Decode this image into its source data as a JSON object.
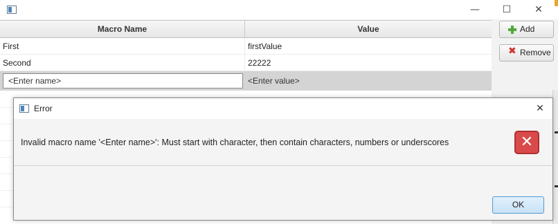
{
  "window": {
    "minimize_glyph": "—",
    "maximize_glyph": "☐",
    "close_glyph": "✕"
  },
  "table": {
    "columns": [
      "Macro Name",
      "Value"
    ],
    "rows": [
      {
        "name": "First",
        "value": "firstValue"
      },
      {
        "name": "Second",
        "value": "22222"
      }
    ],
    "edit_row": {
      "name_value": "<Enter name>",
      "value_placeholder": "<Enter value>"
    }
  },
  "buttons": {
    "add_label": "Add",
    "remove_label": "Remove"
  },
  "dialog": {
    "title": "Error",
    "close_glyph": "✕",
    "message": "Invalid macro name '<Enter name>': Must start with character, then contain characters, numbers or underscores",
    "icon": "error-x-icon",
    "ok_label": "OK"
  },
  "colors": {
    "error_red": "#d94b4b",
    "add_green": "#52a83a",
    "ok_blue": "#4e9ad6"
  }
}
